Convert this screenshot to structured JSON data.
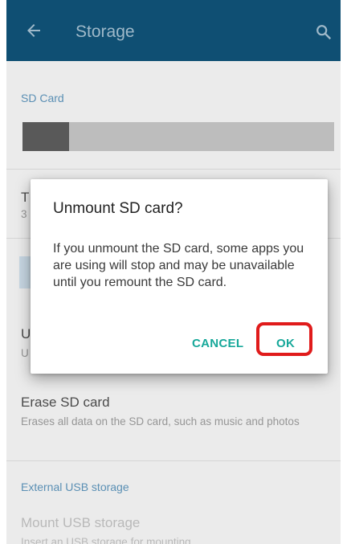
{
  "appbar": {
    "title": "Storage",
    "back_icon": "arrow-back-icon",
    "search_icon": "search-icon"
  },
  "sd_card": {
    "section_label": "SD Card",
    "usage_fraction": 0.15,
    "total_row": {
      "title": "T",
      "subtitle": "3"
    },
    "unmount_row": {
      "title": "U",
      "subtitle": "U"
    },
    "erase_row": {
      "title": "Erase SD card",
      "subtitle": "Erases all data on the SD card, such as music and photos"
    }
  },
  "usb": {
    "section_label": "External USB storage",
    "mount_row": {
      "title": "Mount USB storage",
      "subtitle": "Insert an USB storage for mounting"
    }
  },
  "dialog": {
    "title": "Unmount SD card?",
    "message": "If you unmount the SD card, some apps you are using will stop and may be unavailable until you remount the SD card.",
    "cancel_label": "CANCEL",
    "ok_label": "OK"
  },
  "colors": {
    "appbar": "#0f4f73",
    "accent_text": "#17a89a",
    "highlight": "#e01b1b"
  }
}
